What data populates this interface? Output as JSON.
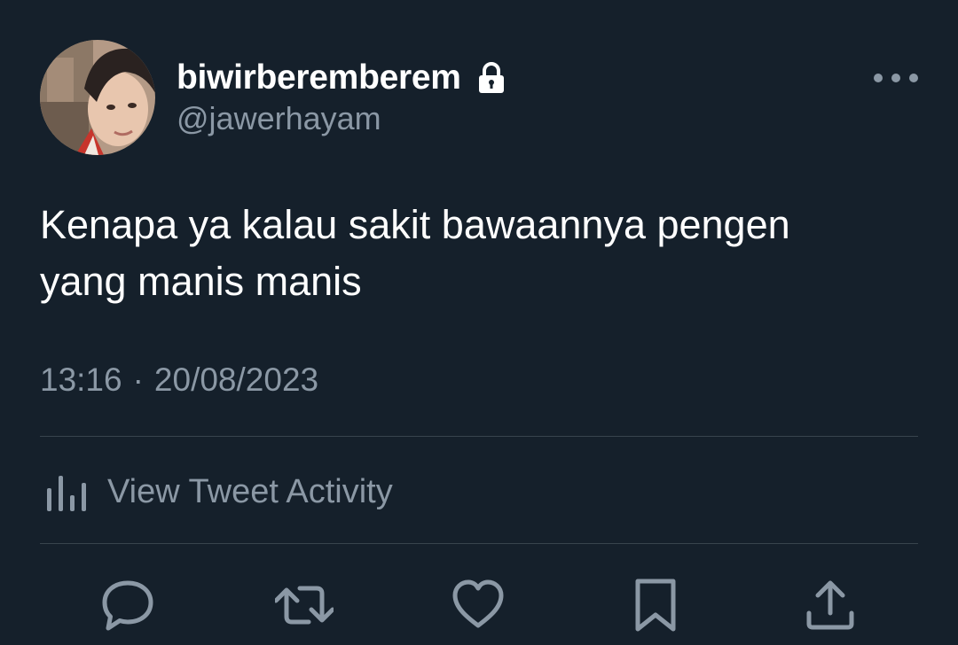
{
  "tweet": {
    "author": {
      "display_name": "biwirberemberem",
      "username": "@jawerhayam",
      "protected_icon": "lock-icon",
      "avatar": "profile-photo"
    },
    "text": "Kenapa ya kalau sakit bawaannya pengen\nyang manis manis",
    "time": "13:16",
    "separator": "·",
    "date": "20/08/2023",
    "activity_label": "View Tweet Activity",
    "icons": {
      "more": "more-horizontal-icon",
      "activity": "bar-chart-icon",
      "reply": "reply-icon",
      "retweet": "retweet-icon",
      "like": "heart-icon",
      "bookmark": "bookmark-icon",
      "share": "share-icon"
    },
    "colors": {
      "background": "#15202b",
      "primary_text": "#ffffff",
      "secondary_text": "#8b98a5",
      "divider": "#38444d"
    }
  }
}
